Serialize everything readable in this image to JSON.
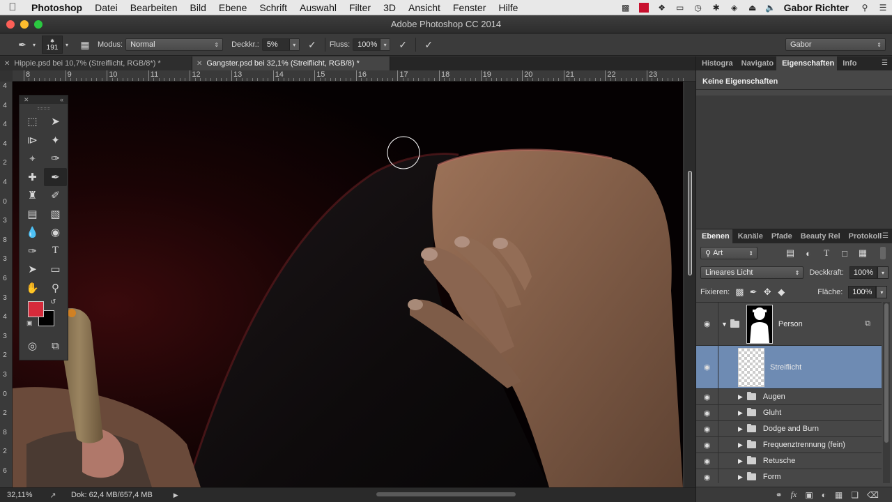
{
  "menubar": {
    "app": "Photoshop",
    "items": [
      "Datei",
      "Bearbeiten",
      "Bild",
      "Ebene",
      "Schrift",
      "Auswahl",
      "Filter",
      "3D",
      "Ansicht",
      "Fenster",
      "Hilfe"
    ],
    "user": "Gabor Richter"
  },
  "window": {
    "title": "Adobe Photoshop CC 2014"
  },
  "options": {
    "brush_size": "191",
    "mode_label": "Modus:",
    "mode_value": "Normal",
    "opacity_label": "Deckkr.:",
    "opacity_value": "5%",
    "flow_label": "Fluss:",
    "flow_value": "100%",
    "workspace": "Gabor"
  },
  "tabs": [
    {
      "label": "Hippie.psd bei 10,7% (Streiflicht, RGB/8*) *",
      "active": false
    },
    {
      "label": "Gangster.psd bei 32,1% (Streiflicht, RGB/8) *",
      "active": true
    }
  ],
  "ruler": {
    "top": [
      "8",
      "9",
      "10",
      "11",
      "12",
      "13",
      "14",
      "15",
      "16",
      "17",
      "18",
      "19",
      "20",
      "21",
      "22",
      "23"
    ],
    "left": [
      "4",
      "4",
      "4",
      "4",
      "2",
      "4",
      "0",
      "3",
      "8",
      "3",
      "6",
      "3",
      "4",
      "3",
      "2",
      "3",
      "0",
      "2",
      "8",
      "2",
      "6"
    ]
  },
  "status": {
    "zoom": "32,11%",
    "doc": "Dok: 62,4 MB/657,4 MB"
  },
  "colors": {
    "foreground": "#d62a3a",
    "background": "#000000",
    "selection": "#6e8bb3"
  },
  "panels": {
    "top_tabs": [
      "Histogra",
      "Navigato",
      "Eigenschaften",
      "Info"
    ],
    "properties_heading": "Keine Eigenschaften",
    "layer_tabs": [
      "Ebenen",
      "Kanäle",
      "Pfade",
      "Beauty Rel",
      "Protokoll"
    ],
    "filter_kind": "Art",
    "blend_mode": "Lineares Licht",
    "opacity_label": "Deckkraft:",
    "opacity_value": "100%",
    "lock_label": "Fixieren:",
    "fill_label": "Fläche:",
    "fill_value": "100%"
  },
  "layers": [
    {
      "name": "Person",
      "type": "group-mask",
      "expanded": true
    },
    {
      "name": "Streiflicht",
      "type": "pixel",
      "selected": true
    },
    {
      "name": "Augen",
      "type": "group"
    },
    {
      "name": "Gluht",
      "type": "group"
    },
    {
      "name": "Dodge and Burn",
      "type": "group"
    },
    {
      "name": "Frequenztrennung (fein)",
      "type": "group"
    },
    {
      "name": "Retusche",
      "type": "group"
    },
    {
      "name": "Form",
      "type": "group"
    }
  ]
}
